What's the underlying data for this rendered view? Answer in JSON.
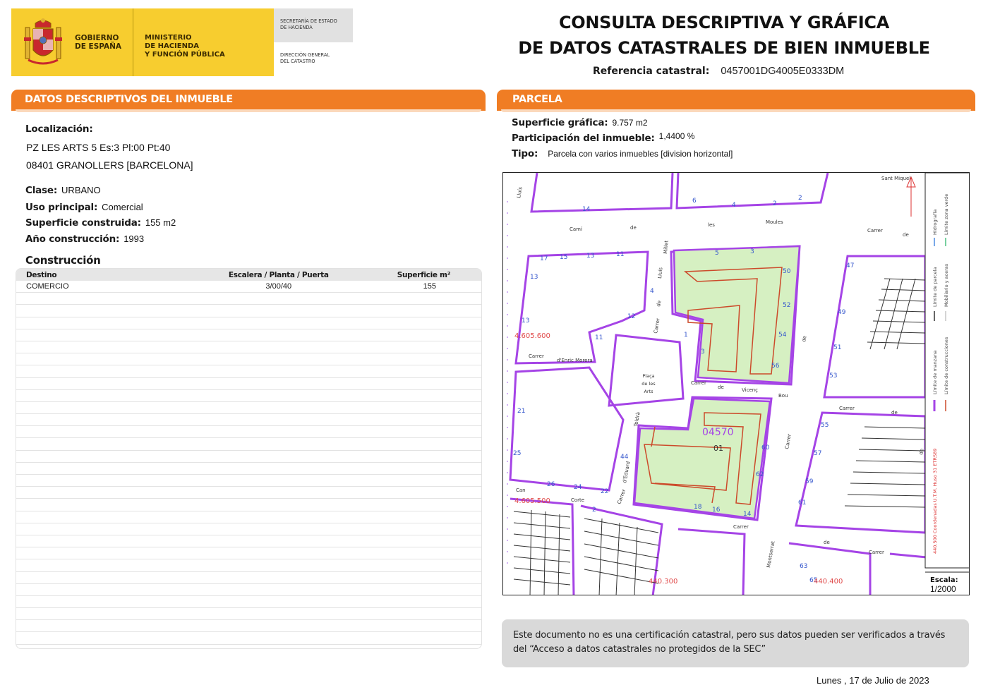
{
  "header": {
    "logo_gobierno": "GOBIERNO\nDE ESPAÑA",
    "logo_ministerio": "MINISTERIO\nDE HACIENDA\nY FUNCIÓN PÚBLICA",
    "logo_secretaria": "SECRETARÍA DE ESTADO\nDE HACIENDA",
    "logo_direccion": "DIRECCIÓN GENERAL\nDEL CATASTRO",
    "title_line1": "CONSULTA DESCRIPTIVA Y GRÁFICA",
    "title_line2": "DE DATOS CATASTRALES DE BIEN INMUEBLE",
    "ref_label": "Referencia catastral:",
    "ref_value": "0457001DG4005E0333DM"
  },
  "descriptive": {
    "section_title": "DATOS DESCRIPTIVOS DEL INMUEBLE",
    "localizacion_label": "Localización:",
    "address_line1": "PZ LES ARTS 5 Es:3 Pl:00 Pt:40",
    "address_line2": "08401 GRANOLLERS [BARCELONA]",
    "clase_label": "Clase:",
    "clase_value": "URBANO",
    "uso_label": "Uso principal:",
    "uso_value": "Comercial",
    "superficie_label": "Superficie construida:",
    "superficie_value": "155 m2",
    "anio_label": "Año construcción:",
    "anio_value": "1993",
    "construccion_title": "Construcción",
    "table_headers": [
      "Destino",
      "Escalera / Planta / Puerta",
      "Superficie m²"
    ],
    "table_rows": [
      [
        "COMERCIO",
        "3/00/40",
        "155"
      ]
    ]
  },
  "parcela": {
    "section_title": "PARCELA",
    "superficie_label": "Superficie gráfica:",
    "superficie_value": "9.757 m2",
    "participacion_label": "Participación del inmueble:",
    "participacion_value": "1,4400 %",
    "tipo_label": "Tipo:",
    "tipo_value": "Parcela con varios inmuebles [division horizontal]"
  },
  "map": {
    "parcel_code": "04570",
    "parcel_sub": "01",
    "coord_y1": "4.605.600",
    "coord_y2": "4.605.500",
    "coord_x1": "440.300",
    "coord_x2": "440.400",
    "street_labels": [
      "Camí",
      "de",
      "les",
      "Moules",
      "Carrer",
      "de",
      "Carrer",
      "d'Enric Morera",
      "Carrer",
      "de",
      "Vicenç",
      "Bou",
      "Carrer",
      "de",
      "Carrer",
      "d'Eduard",
      "Toldrà",
      "Carrer",
      "de",
      "Lluís",
      "Millet",
      "Carrer",
      "de",
      "Can",
      "Corte",
      "Carrer",
      "de",
      "Montserrat",
      "Carrer",
      "de",
      "Sant Miquel",
      "Lluís"
    ],
    "plaza_line1": "Plaça",
    "plaza_line2": "de les",
    "plaza_line3": "Arts",
    "legend": {
      "limite_manzana": "Límite de manzana",
      "limite_construcciones": "Límite de construcciones",
      "limite_parcela": "Límite de parcela",
      "mobiliario": "Mobiliario y aceras",
      "hidrografia": "Hidrografía",
      "limite_zona_verde": "Límite zona verde",
      "coordenadas": "440.500 Coordenadas U.T.M. Huso 31 ETRS89"
    },
    "escala_label": "Escala:",
    "escala_value": "1/2000"
  },
  "footer": {
    "notice": "Este documento no es una certificación catastral, pero sus datos pueden ser verificados a través del “Acceso a datos catastrales no protegidos de la SEC”",
    "date": "Lunes , 17 de Julio de 2023"
  },
  "colors": {
    "orange": "#f07d24",
    "yellow": "#f7cd2f",
    "parcel_green": "#d6f0c2",
    "block_purple": "#a544e6",
    "building_red": "#cc4a2a"
  }
}
